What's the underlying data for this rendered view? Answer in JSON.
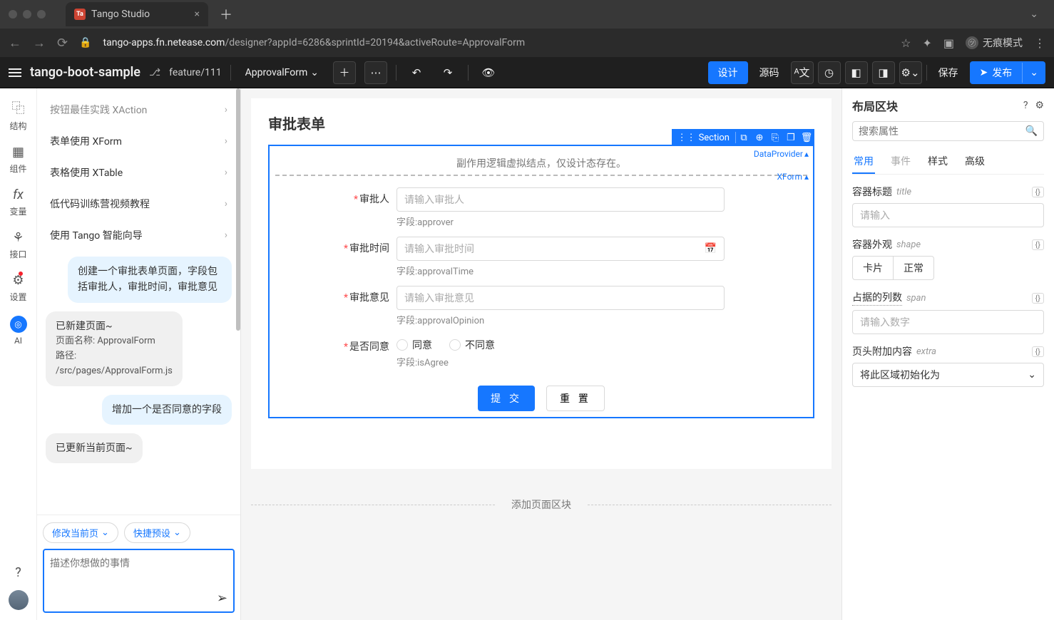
{
  "browser": {
    "tab_title": "Tango Studio",
    "tab_favicon": "Ta",
    "url_host": "tango-apps.fn.netease.com",
    "url_path": "/designer?appId=6286&sprintId=20194&activeRoute=ApprovalForm",
    "incognito_label": "无痕模式"
  },
  "toolbar": {
    "app_name": "tango-boot-sample",
    "branch": "feature/111",
    "page_selector": "ApprovalForm",
    "design": "设计",
    "source": "源码",
    "save": "保存",
    "publish": "发布"
  },
  "left_rail": {
    "structure": "结构",
    "components": "组件",
    "variables": "变量",
    "interfaces": "接口",
    "settings": "设置",
    "ai": "AI"
  },
  "ai_panel": {
    "nav": [
      "按钮最佳实践 XAction",
      "表单使用 XForm",
      "表格使用 XTable",
      "低代码训练营视频教程",
      "使用 Tango 智能向导"
    ],
    "messages": {
      "m1": "创建一个审批表单页面，字段包括审批人，审批时间，审批意见",
      "m2_line1": "已新建页面~",
      "m2_line2": "页面名称: ApprovalForm",
      "m2_line3": "路径:",
      "m2_line4": "/src/pages/ApprovalForm.js",
      "m3": "增加一个是否同意的字段",
      "m4": "已更新当前页面~"
    },
    "quick_edit": "修改当前页",
    "quick_preset": "快捷预设",
    "prompt_placeholder": "描述你想做的事情"
  },
  "canvas": {
    "page_title": "审批表单",
    "section_label": "Section",
    "data_provider": "DataProvider",
    "xform": "XForm",
    "dp_note": "副作用逻辑虚拟结点，仅设计态存在。",
    "fields": {
      "approver": {
        "label": "审批人",
        "placeholder": "请输入审批人",
        "hint": "字段:approver"
      },
      "approvalTime": {
        "label": "审批时间",
        "placeholder": "请输入审批时间",
        "hint": "字段:approvalTime"
      },
      "approvalOpinion": {
        "label": "审批意见",
        "placeholder": "请输入审批意见",
        "hint": "字段:approvalOpinion"
      },
      "isAgree": {
        "label": "是否同意",
        "opt1": "同意",
        "opt2": "不同意",
        "hint": "字段:isAgree"
      }
    },
    "submit": "提 交",
    "reset": "重 置",
    "add_block": "添加页面区块"
  },
  "right_panel": {
    "title": "布局区块",
    "search_placeholder": "搜索属性",
    "tabs": {
      "common": "常用",
      "events": "事件",
      "style": "样式",
      "advanced": "高级"
    },
    "props": {
      "title": {
        "zh": "容器标题",
        "en": "title",
        "placeholder": "请输入"
      },
      "shape": {
        "zh": "容器外观",
        "en": "shape",
        "opt1": "卡片",
        "opt2": "正常"
      },
      "span": {
        "zh": "占据的列数",
        "en": "span",
        "placeholder": "请输入数字"
      },
      "extra": {
        "zh": "页头附加内容",
        "en": "extra",
        "value": "将此区域初始化为"
      }
    }
  }
}
